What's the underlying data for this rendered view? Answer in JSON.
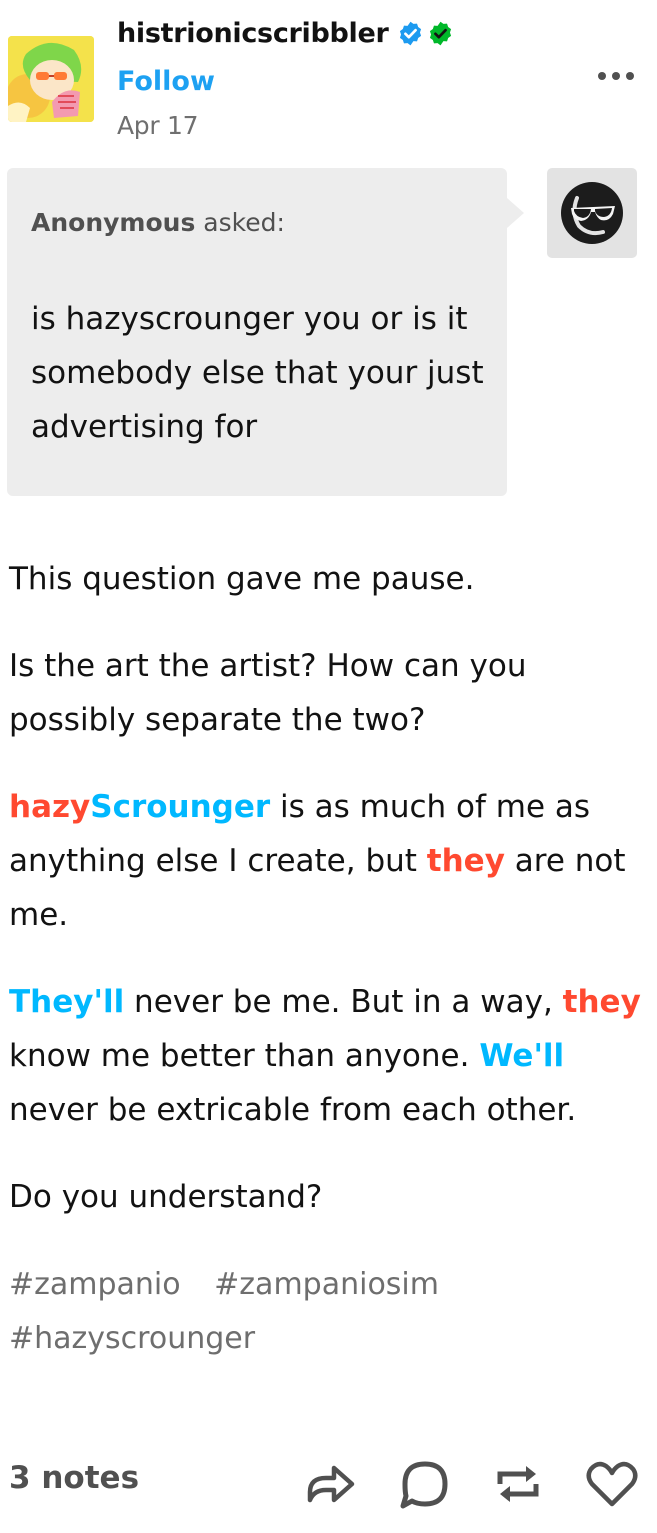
{
  "post": {
    "author": "histrionicscribbler",
    "follow_label": "Follow",
    "date": "Apr 17"
  },
  "ask": {
    "asker": "Anonymous",
    "asked_suffix": "asked:",
    "question": "is hazyscrounger you or is it somebody else that your just advertising for"
  },
  "body": {
    "p1": "This question gave me pause.",
    "p2": "Is the art the artist? How can you possibly separate the two?",
    "p3": {
      "name_a": "hazy",
      "name_b": "Scrounger",
      "mid": " is as much of me as anything else I create, but ",
      "they": "they",
      "end": " are not me."
    },
    "p4": {
      "theyll": "They'll",
      "mid1": " never be me. But in a way, ",
      "they": "they",
      "mid2": " know me better than anyone. ",
      "well": "We'll",
      "end": " never be extricable from each other."
    },
    "p5": "Do you understand?"
  },
  "tags": [
    "#zampanio",
    "#zampaniosim",
    "#hazyscrounger"
  ],
  "footer": {
    "notes": "3 notes"
  },
  "colors": {
    "accent_blue": "#1da1f2",
    "highlight_red": "#ff4930",
    "highlight_blue": "#00b8ff",
    "ask_bg": "#ededed",
    "verified_blue": "#1d9bf0",
    "verified_green": "#00b82a"
  },
  "icons": [
    "verified-badge-icon",
    "green-check-badge-icon",
    "more-options-icon",
    "anonymous-sunglasses-icon",
    "share-icon",
    "reply-icon",
    "reblog-icon",
    "like-heart-icon"
  ]
}
